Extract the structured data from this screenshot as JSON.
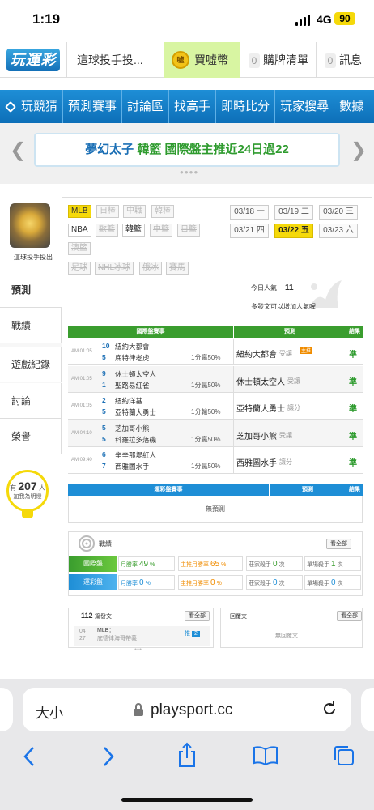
{
  "status": {
    "time": "1:19",
    "network": "4G",
    "battery": "90"
  },
  "topbar": {
    "logo": "玩運彩",
    "user": "這球投手投...",
    "coins_label": "買噓幣",
    "cart_count": "0",
    "cart_label": "購牌清單",
    "msg_count": "0",
    "msg_label": "訊息"
  },
  "nav": {
    "items": [
      "玩競猜",
      "預測賽事",
      "討論區",
      "找高手",
      "即時比分",
      "玩家搜尋",
      "數據"
    ]
  },
  "banner": {
    "name": "夢幻太子",
    "category": "韓籃",
    "text": "國際盤主推近24日過22"
  },
  "profile": {
    "username": "這球投手投出"
  },
  "sidebar": {
    "items": [
      "預測",
      "戰績",
      "遊戲紀錄",
      "討論",
      "榮譽"
    ]
  },
  "counter": {
    "prefix": "有",
    "count": "207",
    "unit": "人",
    "suffix": "加我為明燈"
  },
  "leagues": [
    {
      "label": "MLB",
      "state": "sel"
    },
    {
      "label": "日棒",
      "state": "off"
    },
    {
      "label": "中職",
      "state": "off"
    },
    {
      "label": "韓棒",
      "state": "off"
    },
    {
      "label": "NBA",
      "state": "on"
    },
    {
      "label": "歐籃",
      "state": "off"
    },
    {
      "label": "韓籃",
      "state": "on"
    },
    {
      "label": "中籃",
      "state": "off"
    },
    {
      "label": "日籃",
      "state": "off"
    },
    {
      "label": "澳籃",
      "state": "off"
    },
    {
      "label": "足球",
      "state": "off"
    },
    {
      "label": "NHL冰球",
      "state": "off"
    },
    {
      "label": "俄冰",
      "state": "off"
    },
    {
      "label": "賽馬",
      "state": "off"
    }
  ],
  "dates": [
    {
      "label": "03/18 一",
      "sel": false
    },
    {
      "label": "03/19 二",
      "sel": false
    },
    {
      "label": "03/20 三",
      "sel": false
    },
    {
      "label": "03/21 四",
      "sel": false
    },
    {
      "label": "03/22 五",
      "sel": true
    },
    {
      "label": "03/23 六",
      "sel": false
    }
  ],
  "popularity": {
    "label": "今日人氣",
    "value": "11",
    "hint": "多發文可以增加人氣喔"
  },
  "intl_table": {
    "header": "國際盤賽事",
    "pred_header": "預測",
    "result_header": "結果",
    "games": [
      {
        "time": "AM 01:05",
        "n1": "10",
        "t1": "紐約大都會",
        "n2": "5",
        "t2": "底特律老虎",
        "odds": "1分贏50%",
        "pick": "紐約大都會",
        "pick_tag": "受讓",
        "badge": "主推",
        "result": "準"
      },
      {
        "time": "AM 01:05",
        "n1": "9",
        "t1": "休士頓太空人",
        "n2": "1",
        "t2": "聖路易紅雀",
        "odds": "1分贏50%",
        "pick": "休士頓太空人",
        "pick_tag": "受讓",
        "badge": "",
        "result": "準"
      },
      {
        "time": "AM 01:05",
        "n1": "2",
        "t1": "紐約洋基",
        "n2": "5",
        "t2": "亞特蘭大勇士",
        "odds": "1分輸50%",
        "pick": "亞特蘭大勇士",
        "pick_tag": "讓分",
        "badge": "",
        "result": "準"
      },
      {
        "time": "AM 04:10",
        "n1": "5",
        "t1": "芝加哥小熊",
        "n2": "5",
        "t2": "科羅拉多落磯",
        "odds": "1分贏50%",
        "pick": "芝加哥小熊",
        "pick_tag": "受讓",
        "badge": "",
        "result": "準"
      },
      {
        "time": "AM 09:40",
        "n1": "6",
        "t1": "辛辛那堤紅人",
        "n2": "7",
        "t2": "西雅圖水手",
        "odds": "1分贏50%",
        "pick": "西雅圖水手",
        "pick_tag": "讓分",
        "badge": "",
        "result": "準"
      }
    ]
  },
  "lottery_table": {
    "header": "運彩盤賽事",
    "pred_header": "預測",
    "result_header": "結果",
    "empty": "無預測"
  },
  "stats": {
    "title": "戰績",
    "view_all": "看全部",
    "rows": [
      {
        "label": "國際盤",
        "c1": "月勝率",
        "v1": "49",
        "u1": "%",
        "c2": "主推月勝率",
        "v2": "65",
        "u2": "%",
        "c3": "莊家殺手",
        "v3": "0",
        "u3": "次",
        "c4": "單場殺手",
        "v4": "1",
        "u4": "次"
      },
      {
        "label": "運彩盤",
        "c1": "月勝率",
        "v1": "0",
        "u1": "%",
        "c2": "主推月勝率",
        "v2": "0",
        "u2": "%",
        "c3": "莊家殺手",
        "v3": "0",
        "u3": "次",
        "c4": "單場殺手",
        "v4": "0",
        "u4": "次"
      }
    ]
  },
  "posts": {
    "count": "112",
    "label": "篇發文",
    "view_all": "看全部",
    "item_month": "04",
    "item_day": "27",
    "item_title": "MLB：",
    "item_sub": "底德律海哥帶義",
    "badge": "推",
    "badge_count": "2"
  },
  "replies": {
    "label": "回覆文",
    "view_all": "看全部",
    "empty": "無回覆文"
  },
  "safari": {
    "aa": "大小",
    "url": "playsport.cc"
  },
  "colors": {
    "green": "#3a9d2e",
    "blue": "#1e8ed6",
    "yellow": "#f5d90a",
    "orange": "#f08c00"
  }
}
